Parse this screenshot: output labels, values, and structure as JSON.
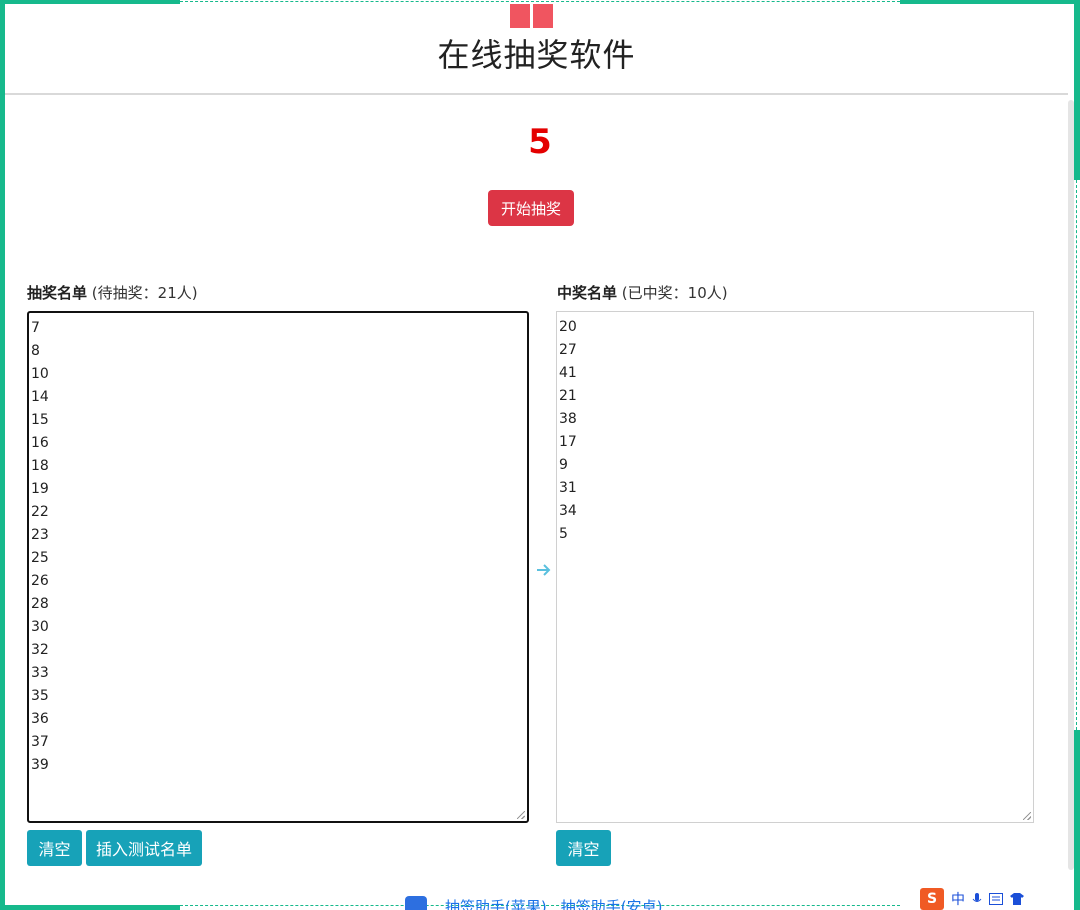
{
  "header": {
    "title": "在线抽奖软件"
  },
  "current_number": "5",
  "start_button": "开始抽奖",
  "pool": {
    "label_bold": "抽奖名单",
    "label_note": "(待抽奖：21人)",
    "entries": [
      "7",
      "8",
      "10",
      "14",
      "15",
      "16",
      "18",
      "19",
      "22",
      "23",
      "25",
      "26",
      "28",
      "30",
      "32",
      "33",
      "35",
      "36",
      "37",
      "39"
    ],
    "clear_button": "清空",
    "insert_button": "插入测试名单"
  },
  "winners": {
    "label_bold": "中奖名单",
    "label_note": "(已中奖：10人)",
    "entries": [
      "20",
      "27",
      "41",
      "21",
      "38",
      "17",
      "9",
      "31",
      "34",
      "5"
    ],
    "clear_button": "清空"
  },
  "footer": {
    "link_apple": "抽签助手(苹果)",
    "link_android": "抽签助手(安卓)"
  },
  "ime": {
    "logo": "S",
    "mode": "中"
  },
  "colors": {
    "accent_green": "#16b98c",
    "danger": "#dc3545",
    "info": "#17a2b8",
    "number_red": "#e40000"
  },
  "icons": [
    "gift-icon",
    "arrow-right-icon",
    "app-icon",
    "ime-logo-icon",
    "microphone-icon",
    "keyboard-icon",
    "shirt-icon"
  ]
}
